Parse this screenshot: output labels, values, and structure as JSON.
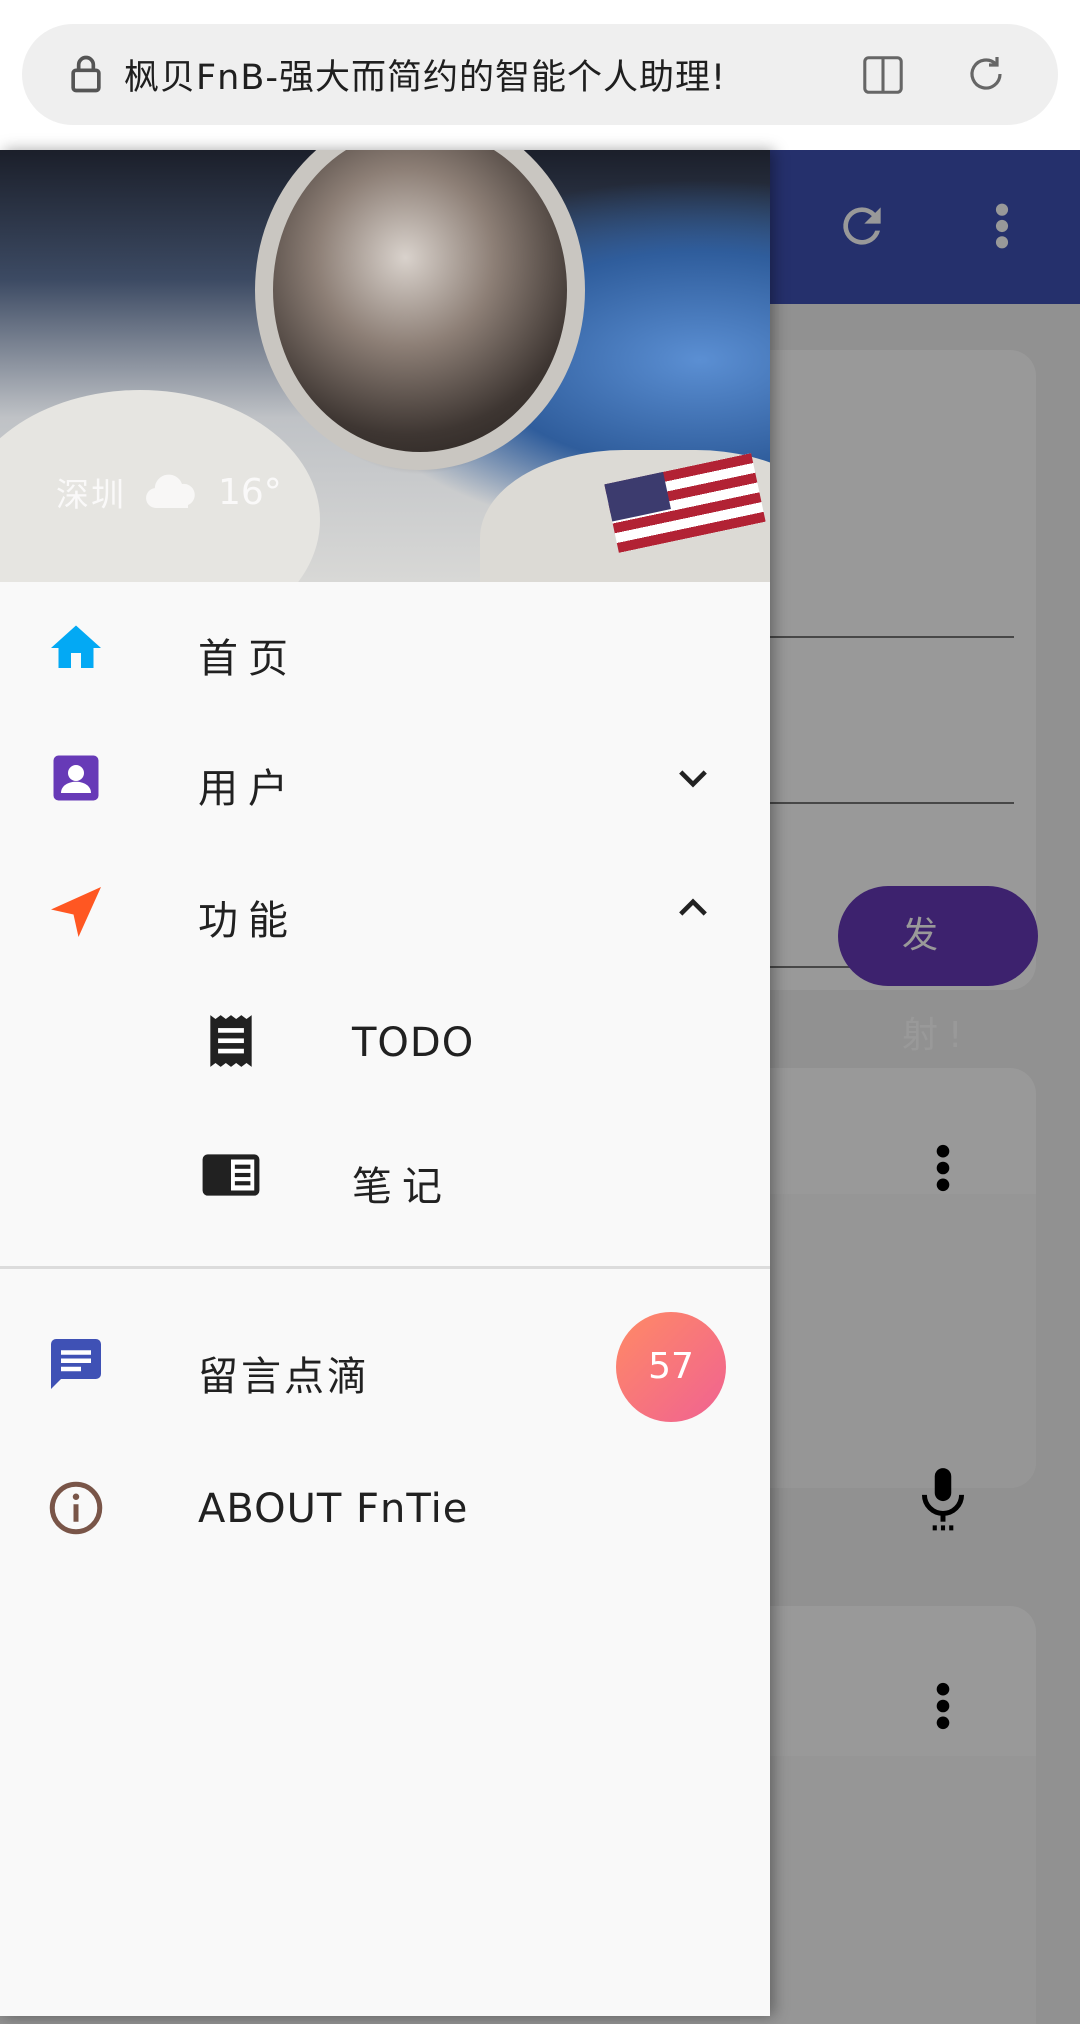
{
  "browser": {
    "url_title": "枫贝FnB-强大而简约的智能个人助理!",
    "icons": [
      "lock-icon",
      "reader-mode-icon",
      "reload-icon"
    ]
  },
  "page": {
    "app_bar_color": "#3f51b5",
    "launch_button_label": "发 射!",
    "icons": [
      "refresh-icon",
      "more-vert-icon",
      "mic-icon"
    ]
  },
  "drawer": {
    "header": {
      "city": "深圳",
      "temperature": "16°",
      "weather_icon": "cloud-icon"
    },
    "menu": {
      "home": {
        "label": "首页",
        "icon": "home-icon",
        "color": "#03a9f4"
      },
      "user": {
        "label": "用户",
        "icon": "account-box-icon",
        "color": "#673ab7",
        "expanded": false
      },
      "features": {
        "label": "功能",
        "icon": "navigation-icon",
        "color": "#ff5722",
        "expanded": true,
        "children": [
          {
            "label": "TODO",
            "icon": "receipt-icon"
          },
          {
            "label": "笔记",
            "icon": "chrome-reader-mode-icon"
          }
        ]
      },
      "messages": {
        "label": "留言点滴",
        "icon": "message-icon",
        "color": "#3f51b5",
        "badge": "57"
      },
      "about": {
        "label": "ABOUT FnTie",
        "icon": "info-icon",
        "color": "#795548"
      }
    }
  }
}
